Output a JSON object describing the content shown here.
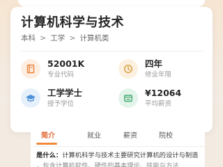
{
  "major": {
    "title": "计算机科学与技术",
    "breadcrumb": [
      "本科",
      "工学",
      "计算机类"
    ],
    "breadcrumb_separator": ">"
  },
  "stats": [
    {
      "value": "52001K",
      "label": "专业代码",
      "icon": "book-icon",
      "color": "#e8813a",
      "bg": "#fdeee1"
    },
    {
      "value": "四年",
      "label": "修业年限",
      "icon": "clock-icon",
      "color": "#d99a3a",
      "bg": "#fcf1e0"
    },
    {
      "value": "工学学士",
      "label": "授予学位",
      "icon": "graduation-cap-icon",
      "color": "#4a90d9",
      "bg": "#e5f0fb"
    },
    {
      "value": "¥12064",
      "label": "平均薪资",
      "icon": "wallet-icon",
      "color": "#3fa86b",
      "bg": "#e3f4ea"
    }
  ],
  "tabs": [
    "简介",
    "就业",
    "薪资",
    "院校"
  ],
  "active_tab": "简介",
  "description": {
    "lead": "是什么：",
    "line1": "计算机科学与技术主要研究计算机的设计与制造",
    "line2": "，包含计算机软件、硬件的基本理论、技能与方法"
  },
  "colors": {
    "accent": "#e0662d",
    "underline": "#f08a3a"
  }
}
